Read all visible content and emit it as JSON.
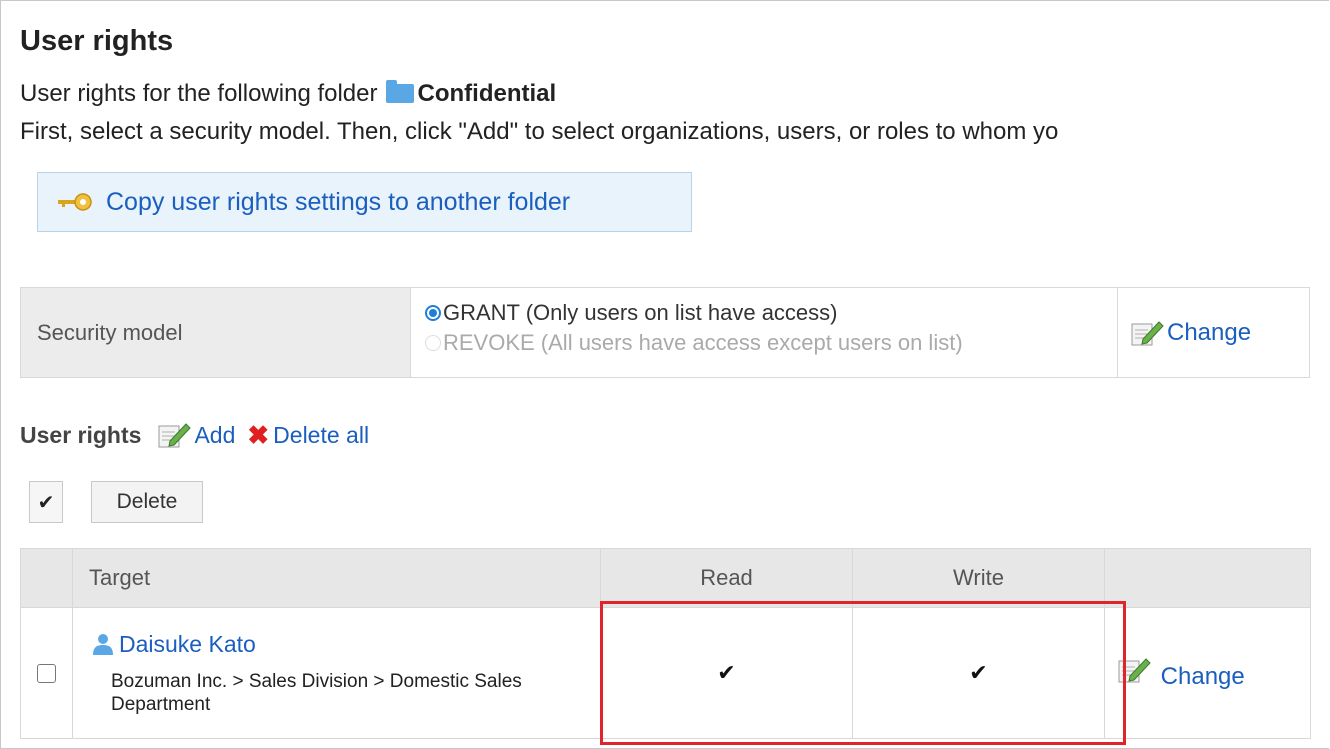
{
  "page": {
    "title": "User rights",
    "folder_prefix": "User rights for the following folder",
    "folder_name": "Confidential",
    "instruction": "First, select a security model. Then, click \"Add\" to select organizations, users, or roles to whom yo"
  },
  "copy_button": {
    "label": "Copy user rights settings to another folder"
  },
  "security_model": {
    "label": "Security model",
    "options": [
      {
        "label": "GRANT (Only users on list have access)",
        "selected": true
      },
      {
        "label": "REVOKE (All users have access except users on list)",
        "selected": false
      }
    ],
    "change_label": "Change"
  },
  "rights": {
    "label": "User rights",
    "add_label": "Add",
    "delete_all_label": "Delete all"
  },
  "toolbar": {
    "check_glyph": "✔",
    "delete_label": "Delete"
  },
  "table": {
    "headers": {
      "target": "Target",
      "read": "Read",
      "write": "Write"
    },
    "rows": [
      {
        "name": "Daisuke Kato",
        "path": "Bozuman Inc. > Sales Division > Domestic Sales Department",
        "read": "✔",
        "write": "✔",
        "change_label": "Change"
      }
    ]
  },
  "colors": {
    "link": "#1a5fbf",
    "highlight": "#e0242b",
    "radio": "#1e7fd6"
  }
}
